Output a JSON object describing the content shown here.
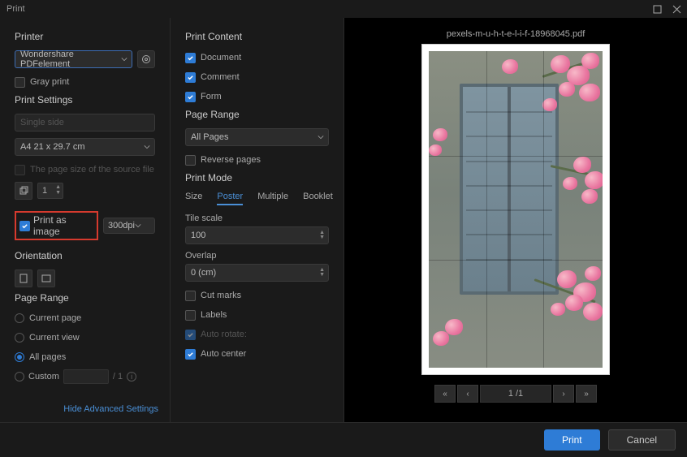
{
  "window": {
    "title": "Print"
  },
  "col1": {
    "printer_label": "Printer",
    "printer_value": "Wondershare PDFelement",
    "gray_print": "Gray print",
    "print_settings": "Print Settings",
    "single_side": "Single side",
    "paper": "A4 21 x 29.7 cm",
    "source_size": "The page size of the source file",
    "copies": "1",
    "print_as_image": "Print as image",
    "dpi": "300dpi",
    "orientation": "Orientation",
    "page_range": "Page Range",
    "range": {
      "current_page": "Current page",
      "current_view": "Current view",
      "all_pages": "All pages",
      "custom": "Custom"
    },
    "custom_hint": "/ 1",
    "hide_advanced": "Hide Advanced Settings"
  },
  "col2": {
    "print_content": "Print Content",
    "document": "Document",
    "comment": "Comment",
    "form": "Form",
    "page_range": "Page Range",
    "all_pages": "All Pages",
    "reverse": "Reverse pages",
    "print_mode": "Print Mode",
    "tabs": {
      "size": "Size",
      "poster": "Poster",
      "multiple": "Multiple",
      "booklet": "Booklet"
    },
    "tile_scale_label": "Tile scale",
    "tile_scale": "100",
    "overlap_label": "Overlap",
    "overlap": "0  (cm)",
    "cut_marks": "Cut marks",
    "labels": "Labels",
    "auto_rotate": "Auto rotate:",
    "auto_center": "Auto center"
  },
  "preview": {
    "filename": "pexels-m-u-h-t-e-l-i-f-18968045.pdf",
    "page_text": "1 /1"
  },
  "footer": {
    "print": "Print",
    "cancel": "Cancel"
  }
}
